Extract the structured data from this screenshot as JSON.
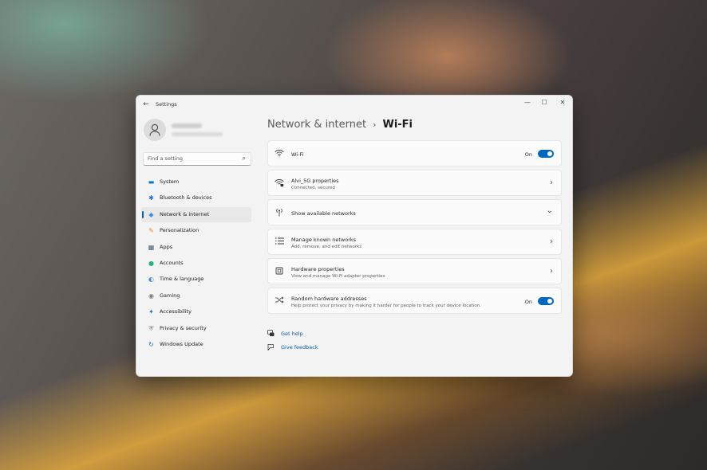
{
  "app": {
    "title": "Settings",
    "back_icon": "arrow-left-icon"
  },
  "window_controls": {
    "minimize": "—",
    "maximize": "☐",
    "close": "✕"
  },
  "search": {
    "placeholder": "Find a setting",
    "icon": "⌕"
  },
  "nav": {
    "items": [
      {
        "label": "System",
        "icon": "▬",
        "color": "#0078d4"
      },
      {
        "label": "Bluetooth & devices",
        "icon": "✱",
        "color": "#1a73c8"
      },
      {
        "label": "Network & internet",
        "icon": "◆",
        "color": "#3a8ee6",
        "active": true
      },
      {
        "label": "Personalization",
        "icon": "✎",
        "color": "#e08a2a"
      },
      {
        "label": "Apps",
        "icon": "▦",
        "color": "#4a5a70"
      },
      {
        "label": "Accounts",
        "icon": "●",
        "color": "#2bb08a"
      },
      {
        "label": "Time & language",
        "icon": "◐",
        "color": "#3a8ee6"
      },
      {
        "label": "Gaming",
        "icon": "◉",
        "color": "#7a7a7a"
      },
      {
        "label": "Accessibility",
        "icon": "✦",
        "color": "#1a73c8"
      },
      {
        "label": "Privacy & security",
        "icon": "⛨",
        "color": "#7a8796"
      },
      {
        "label": "Windows Update",
        "icon": "↻",
        "color": "#1a73c8"
      }
    ]
  },
  "header": {
    "parent": "Network & internet",
    "separator": "›",
    "current": "Wi-Fi"
  },
  "cards": {
    "wifi": {
      "title": "Wi-Fi",
      "state": "On",
      "icon": "wifi-icon"
    },
    "properties": {
      "title": "Alvi_5G properties",
      "sub": "Connected, secured",
      "chevron": "›"
    },
    "available": {
      "title": "Show available networks",
      "chevron": "⌄"
    },
    "known": {
      "title": "Manage known networks",
      "sub": "Add, remove, and edit networks",
      "chevron": "›"
    },
    "hardware": {
      "title": "Hardware properties",
      "sub": "View and manage Wi-Fi adapter properties",
      "chevron": "›"
    },
    "random": {
      "title": "Random hardware addresses",
      "sub": "Help protect your privacy by making it harder for people to track your device location.",
      "state": "On"
    }
  },
  "links": {
    "help": "Get help",
    "feedback": "Give feedback"
  },
  "colors": {
    "accent": "#0067c0",
    "link": "#0a58b0"
  }
}
